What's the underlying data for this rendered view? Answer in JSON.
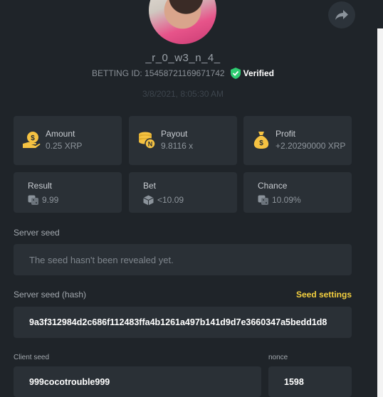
{
  "profile": {
    "username": "_r_0_w3_n_4_",
    "betting_id": "BETTING ID: 15458721169671742",
    "verified_label": "Verified",
    "timestamp": "3/8/2021, 8:05:30 AM"
  },
  "stats_top": [
    {
      "label": "Amount",
      "value": "0.25 XRP",
      "icon": "coin-hand-icon"
    },
    {
      "label": "Payout",
      "value": "9.8116 x",
      "icon": "coin-stack-icon"
    },
    {
      "label": "Profit",
      "value": "+2.20290000 XRP",
      "icon": "money-bag-icon"
    }
  ],
  "stats_bottom": [
    {
      "label": "Result",
      "value": "9.99",
      "icon": "dice-icon"
    },
    {
      "label": "Bet",
      "value": "<10.09",
      "icon": "cube-icon"
    },
    {
      "label": "Chance",
      "value": "10.09%",
      "icon": "dice-icon"
    }
  ],
  "server_seed": {
    "label": "Server seed",
    "value": "The seed hasn't been revealed yet."
  },
  "server_seed_hash": {
    "label": "Server seed (hash)",
    "settings_link": "Seed settings",
    "value": "9a3f312984d2c686f112483ffa4b1261a497b141d9d7e3660347a5bedd1d8"
  },
  "client_seed": {
    "label": "Client seed",
    "value": "999cocotrouble999"
  },
  "nonce": {
    "label": "nonce",
    "value": "1598"
  },
  "colors": {
    "background": "#1f2429",
    "card": "#2a3036",
    "accent_yellow": "#f4d03f",
    "verified_green": "#2ecc71"
  }
}
